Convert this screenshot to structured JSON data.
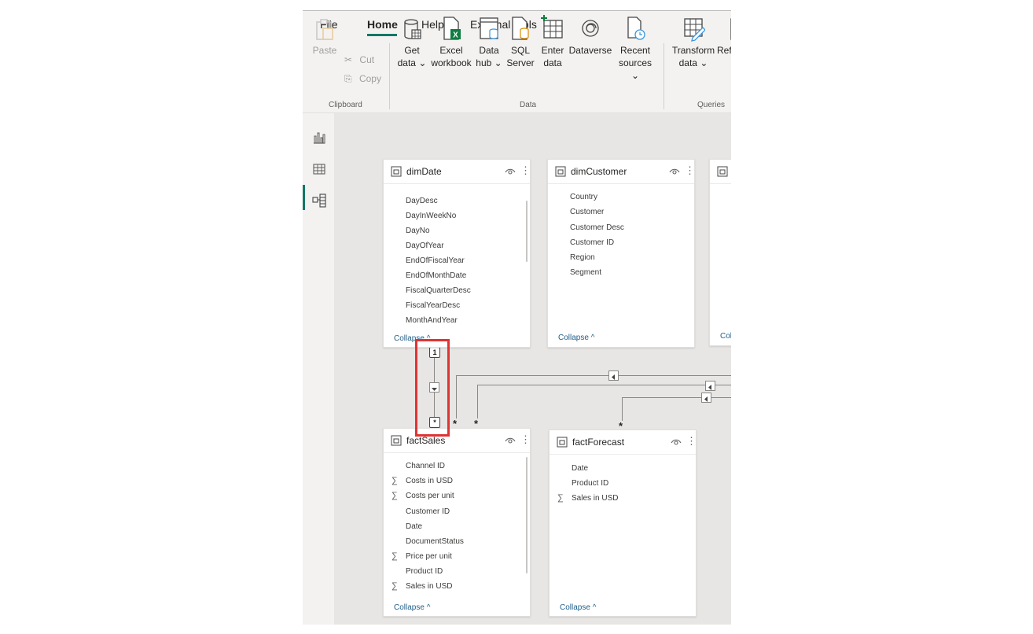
{
  "menu": {
    "file": "File",
    "home": "Home",
    "help": "Help",
    "external_tools": "External tools"
  },
  "clipboard": {
    "paste": "Paste",
    "cut": "Cut",
    "copy": "Copy",
    "group": "Clipboard"
  },
  "data_group": {
    "get_data": [
      "Get",
      "data ⌄"
    ],
    "excel": [
      "Excel",
      "workbook"
    ],
    "data_hub": [
      "Data",
      "hub ⌄"
    ],
    "sql": [
      "SQL",
      "Server"
    ],
    "enter": [
      "Enter",
      "data"
    ],
    "dataverse": [
      "Dataverse",
      ""
    ],
    "recent": [
      "Recent",
      "sources ⌄"
    ],
    "group": "Data"
  },
  "queries_group": {
    "transform": [
      "Transform",
      "data ⌄"
    ],
    "refresh": "Ref",
    "group": "Queries"
  },
  "rail": [
    "report-view-icon",
    "data-view-icon",
    "model-view-icon"
  ],
  "tables": {
    "dimDate": {
      "title": "dimDate",
      "fields": [
        "DayDesc",
        "DayInWeekNo",
        "DayNo",
        "DayOfYear",
        "EndOfFiscalYear",
        "EndOfMonthDate",
        "FiscalQuarterDesc",
        "FiscalYearDesc",
        "MonthAndYear"
      ],
      "collapse": "Collapse ^"
    },
    "dimCustomer": {
      "title": "dimCustomer",
      "fields": [
        "Country",
        "Customer",
        "Customer Desc",
        "Customer ID",
        "Region",
        "Segment"
      ],
      "collapse": "Collapse ^"
    },
    "third": {
      "collapse": "Coll"
    },
    "factSales": {
      "title": "factSales",
      "fields": [
        {
          "name": "Channel ID",
          "sigma": false
        },
        {
          "name": "Costs in USD",
          "sigma": true
        },
        {
          "name": "Costs per unit",
          "sigma": true
        },
        {
          "name": "Customer ID",
          "sigma": false
        },
        {
          "name": "Date",
          "sigma": false
        },
        {
          "name": "DocumentStatus",
          "sigma": false
        },
        {
          "name": "Price per unit",
          "sigma": true
        },
        {
          "name": "Product ID",
          "sigma": false
        },
        {
          "name": "Sales in USD",
          "sigma": true
        }
      ],
      "collapse": "Collapse ^"
    },
    "factForecast": {
      "title": "factForecast",
      "fields": [
        {
          "name": "Date",
          "sigma": false
        },
        {
          "name": "Product ID",
          "sigma": false
        },
        {
          "name": "Sales in USD",
          "sigma": true
        }
      ],
      "collapse": "Collapse ^"
    }
  },
  "relationship": {
    "one": "1",
    "many": "*",
    "sigma_symbol": "∑",
    "more": "⋮"
  }
}
